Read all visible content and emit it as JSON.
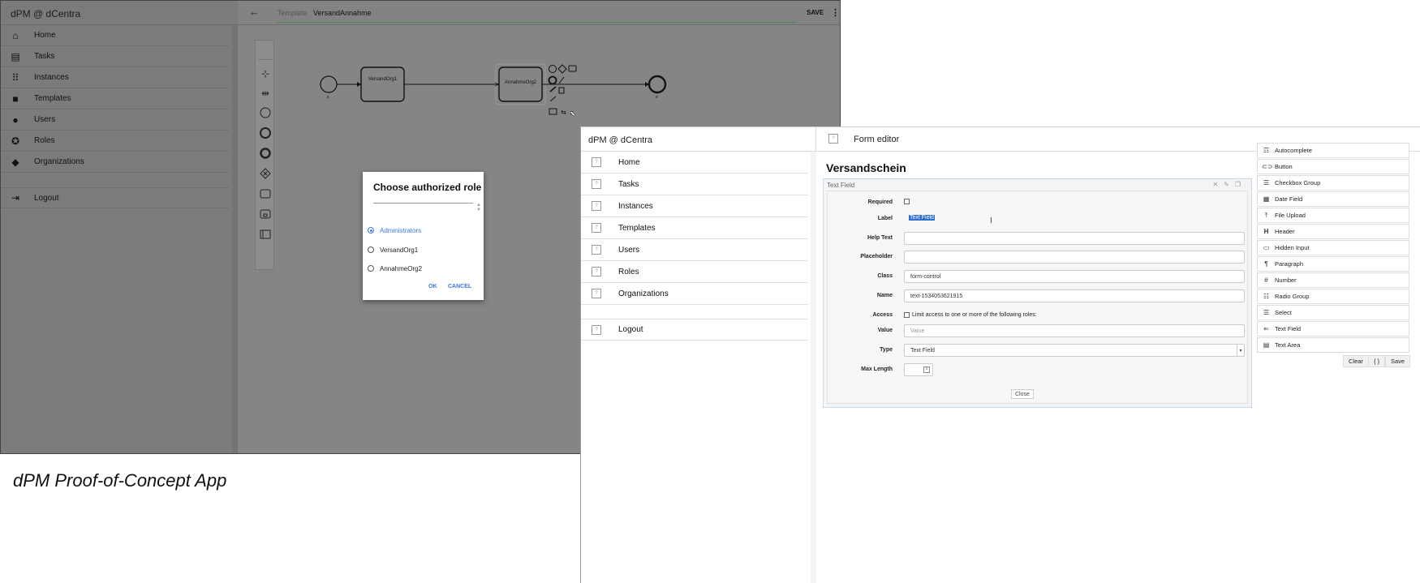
{
  "left_app": {
    "app_title": "dPM @ dCentra",
    "sidebar": [
      {
        "label": "Home",
        "icon": "home-icon"
      },
      {
        "label": "Tasks",
        "icon": "clipboard-icon"
      },
      {
        "label": "Instances",
        "icon": "grid-icon"
      },
      {
        "label": "Templates",
        "icon": "layers-icon"
      },
      {
        "label": "Users",
        "icon": "user-icon"
      },
      {
        "label": "Roles",
        "icon": "badge-icon"
      },
      {
        "label": "Organizations",
        "icon": "cube-icon"
      },
      {
        "label": "Logout",
        "icon": "logout-icon"
      }
    ],
    "topbar": {
      "back_label": "←",
      "template_label": "Template",
      "template_value": "VersandAnnahme",
      "save_label": "SAVE",
      "menu_label": "⋮"
    },
    "diagram": {
      "start_label": "s",
      "end_label": "e",
      "task1": "VersandOrg1",
      "task2": "AnnahmeOrg2"
    },
    "dialog": {
      "title": "Choose authorized role",
      "options": [
        "Administrators",
        "VersandOrg1",
        "AnnahmeOrg2"
      ],
      "selected": "Administrators",
      "ok_label": "OK",
      "cancel_label": "CANCEL"
    }
  },
  "caption": "dPM Proof-of-Concept App",
  "right_app": {
    "app_title": "dPM @ dCentra",
    "page_title": "Form editor",
    "sidebar": [
      {
        "label": "Home"
      },
      {
        "label": "Tasks"
      },
      {
        "label": "Instances"
      },
      {
        "label": "Templates"
      },
      {
        "label": "Users"
      },
      {
        "label": "Roles"
      },
      {
        "label": "Organizations"
      },
      {
        "label": "Logout"
      }
    ],
    "form": {
      "title": "Versandschein",
      "field_title": "Text Field",
      "required_label": "Required",
      "label_label": "Label",
      "label_value": "Text Field",
      "help_label": "Help Text",
      "placeholder_label": "Placeholder",
      "class_label": "Class",
      "class_value": "form-control",
      "name_label": "Name",
      "name_value": "text-1534053621915",
      "access_label": "Access",
      "access_text": "Limit access to one or more of the following roles:",
      "value_label": "Value",
      "value_placeholder": "Value",
      "type_label": "Type",
      "type_value": "Text Field",
      "maxlen_label": "Max Length",
      "close_label": "Close"
    },
    "controls": [
      {
        "label": "Autocomplete",
        "icon": "autocomplete-icon"
      },
      {
        "label": "Button",
        "icon": "button-icon"
      },
      {
        "label": "Checkbox Group",
        "icon": "checkbox-group-icon"
      },
      {
        "label": "Date Field",
        "icon": "calendar-icon"
      },
      {
        "label": "File Upload",
        "icon": "upload-icon"
      },
      {
        "label": "Header",
        "icon": "header-icon"
      },
      {
        "label": "Hidden Input",
        "icon": "hidden-input-icon"
      },
      {
        "label": "Paragraph",
        "icon": "paragraph-icon"
      },
      {
        "label": "Number",
        "icon": "number-icon"
      },
      {
        "label": "Radio Group",
        "icon": "radio-group-icon"
      },
      {
        "label": "Select",
        "icon": "select-icon"
      },
      {
        "label": "Text Field",
        "icon": "text-field-icon"
      },
      {
        "label": "Text Area",
        "icon": "text-area-icon"
      }
    ],
    "actions": {
      "clear_label": "Clear",
      "json_label": "{ }",
      "save_label": "Save"
    }
  }
}
